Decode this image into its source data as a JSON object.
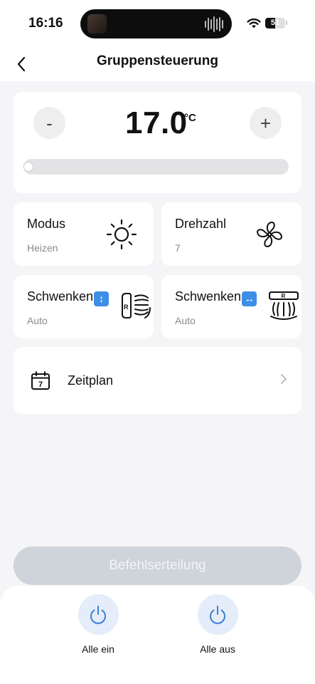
{
  "status_bar": {
    "time": "16:16",
    "battery": "51",
    "battery_level": 0.51
  },
  "nav": {
    "title": "Gruppensteuerung",
    "back_icon": "chevron-left-icon"
  },
  "temperature": {
    "value": "17.0",
    "unit": "°C",
    "minus_label": "-",
    "plus_label": "+",
    "slider_level": 0.0
  },
  "tiles": {
    "mode": {
      "title": "Modus",
      "value": "Heizen",
      "icon": "sun-icon"
    },
    "fan_speed": {
      "title": "Drehzahl",
      "value": "7",
      "icon": "fan-icon"
    },
    "swing_vertical": {
      "title": "Schwenken",
      "badge": "↕",
      "value": "Auto",
      "icon": "vertical-swing-icon"
    },
    "swing_horizontal": {
      "title": "Schwenken",
      "badge": "↔",
      "value": "Auto",
      "icon": "horizontal-swing-icon"
    }
  },
  "schedule": {
    "label": "Zeitplan",
    "icon_text": "7",
    "icon": "calendar-icon",
    "chevron": "chevron-right-icon"
  },
  "command": {
    "label": "Befehlserteilung"
  },
  "power": {
    "on": {
      "label": "Alle ein",
      "icon": "power-icon"
    },
    "off": {
      "label": "Alle aus",
      "icon": "power-icon"
    }
  },
  "colors": {
    "accent": "#3d7fd6",
    "disabled_button": "#cfd3da",
    "power_bg": "#e4edf9"
  }
}
